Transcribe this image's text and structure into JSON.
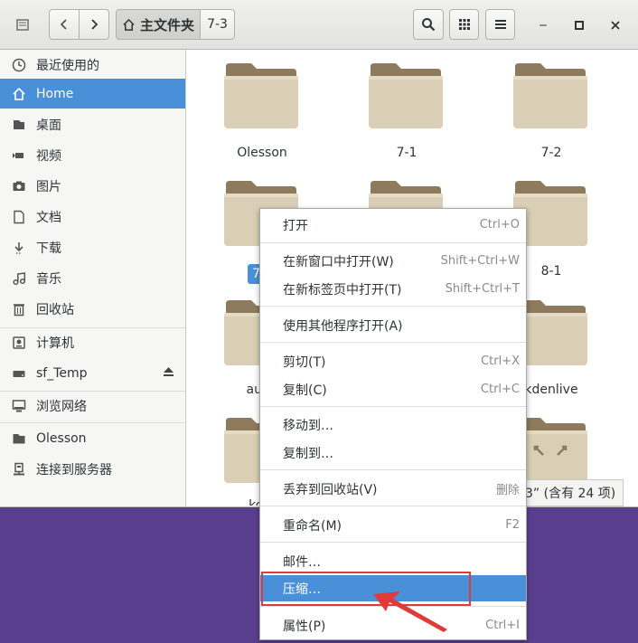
{
  "toolbar": {
    "path_home": "主文件夹",
    "path_current": "7-3"
  },
  "sidebar": {
    "items": [
      {
        "label": "最近使用的",
        "icon": "recent-icon"
      },
      {
        "label": "Home",
        "icon": "home-icon"
      },
      {
        "label": "桌面",
        "icon": "desktop-icon"
      },
      {
        "label": "视频",
        "icon": "video-icon"
      },
      {
        "label": "图片",
        "icon": "camera-icon"
      },
      {
        "label": "文档",
        "icon": "document-icon"
      },
      {
        "label": "下载",
        "icon": "download-icon"
      },
      {
        "label": "音乐",
        "icon": "music-icon"
      },
      {
        "label": "回收站",
        "icon": "trash-icon"
      },
      {
        "label": "计算机",
        "icon": "computer-icon"
      },
      {
        "label": "sf_Temp",
        "icon": "drive-icon"
      },
      {
        "label": "浏览网络",
        "icon": "network-icon"
      },
      {
        "label": "Olesson",
        "icon": "folder-icon"
      },
      {
        "label": "连接到服务器",
        "icon": "server-icon"
      }
    ]
  },
  "files": [
    {
      "name": "Olesson"
    },
    {
      "name": "7-1"
    },
    {
      "name": "7-2"
    },
    {
      "name": "7"
    },
    {
      "name": ""
    },
    {
      "name": "8-1"
    },
    {
      "name": "auda"
    },
    {
      "name": ""
    },
    {
      "name": "kdenlive"
    },
    {
      "name": "kom"
    },
    {
      "name": ""
    },
    {
      "name": ""
    }
  ],
  "status": {
    "text": "3” (含有 24 项)"
  },
  "context_menu": {
    "items": [
      {
        "label": "打开",
        "accel": "Ctrl+O"
      },
      {
        "label": "在新窗口中打开(W)",
        "accel": "Shift+Ctrl+W"
      },
      {
        "label": "在新标签页中打开(T)",
        "accel": "Shift+Ctrl+T"
      },
      {
        "label": "使用其他程序打开(A)",
        "accel": ""
      },
      {
        "label": "剪切(T)",
        "accel": "Ctrl+X"
      },
      {
        "label": "复制(C)",
        "accel": "Ctrl+C"
      },
      {
        "label": "移动到…",
        "accel": ""
      },
      {
        "label": "复制到…",
        "accel": ""
      },
      {
        "label": "丢弃到回收站(V)",
        "accel": "删除"
      },
      {
        "label": "重命名(M)",
        "accel": "F2"
      },
      {
        "label": "邮件…",
        "accel": ""
      },
      {
        "label": "压缩…",
        "accel": ""
      },
      {
        "label": "属性(P)",
        "accel": "Ctrl+I"
      }
    ]
  },
  "colors": {
    "accent": "#4a90d9",
    "highlight_box": "#e03a3a",
    "folder": "#d8cbb0"
  }
}
